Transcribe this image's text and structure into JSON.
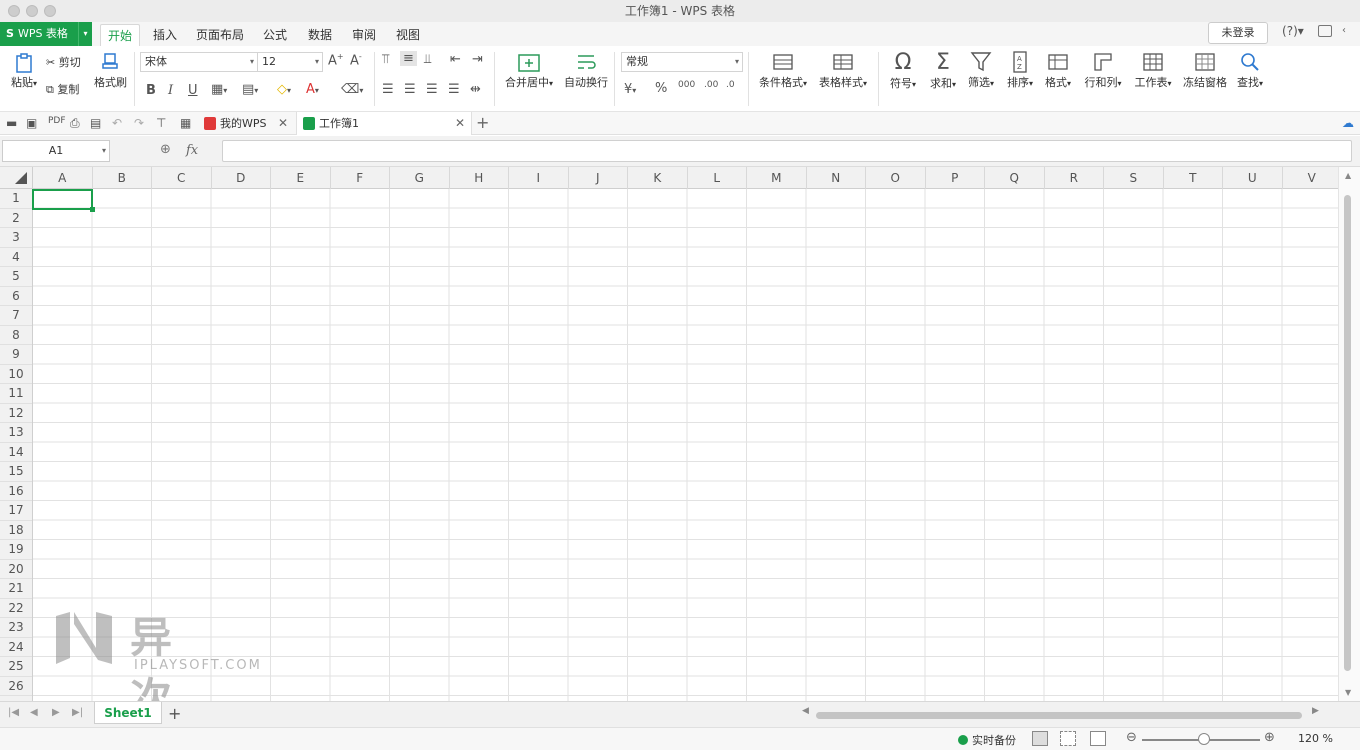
{
  "window": {
    "title": "工作簿1 - WPS 表格"
  },
  "menu": {
    "app_label": "WPS 表格",
    "tabs": [
      "开始",
      "插入",
      "页面布局",
      "公式",
      "数据",
      "审阅",
      "视图"
    ],
    "active_tab": "开始",
    "login_label": "未登录",
    "help_label": "?"
  },
  "ribbon": {
    "paste": "粘贴",
    "cut": "剪切",
    "copy": "复制",
    "format_painter": "格式刷",
    "font_name": "宋体",
    "font_size": "12",
    "merge_center": "合并居中",
    "wrap_text": "自动换行",
    "number_format": "常规",
    "cond_format": "条件格式",
    "table_style": "表格样式",
    "symbol": "符号",
    "sum": "求和",
    "filter": "筛选",
    "sort": "排序",
    "format": "格式",
    "row_col": "行和列",
    "worksheet": "工作表",
    "freeze": "冻结窗格",
    "find": "查找"
  },
  "doc_tabs": [
    {
      "label": "我的WPS",
      "icon": "wps-logo-icon"
    },
    {
      "label": "工作簿1",
      "icon": "spreadsheet-doc-icon"
    }
  ],
  "formula_bar": {
    "name_box": "A1",
    "fx": "fx",
    "value": ""
  },
  "grid": {
    "columns": [
      "A",
      "B",
      "C",
      "D",
      "E",
      "F",
      "G",
      "H",
      "I",
      "J",
      "K",
      "L",
      "M",
      "N",
      "O",
      "P",
      "Q",
      "R",
      "S",
      "T",
      "U",
      "V"
    ],
    "rows": [
      "1",
      "2",
      "3",
      "4",
      "5",
      "6",
      "7",
      "8",
      "9",
      "10",
      "11",
      "12",
      "13",
      "14",
      "15",
      "16",
      "17",
      "18",
      "19",
      "20",
      "21",
      "22",
      "23",
      "24",
      "25",
      "26"
    ],
    "selected_cell": "A1"
  },
  "sheets": {
    "tabs": [
      "Sheet1"
    ],
    "active": "Sheet1"
  },
  "status": {
    "backup_label": "实时备份",
    "zoom": "120 %"
  },
  "watermark": {
    "zh": "异次元",
    "en": "IPLAYSOFT.COM"
  },
  "colors": {
    "accent": "#1a9f4b",
    "grid_line": "#e2e2e2"
  }
}
